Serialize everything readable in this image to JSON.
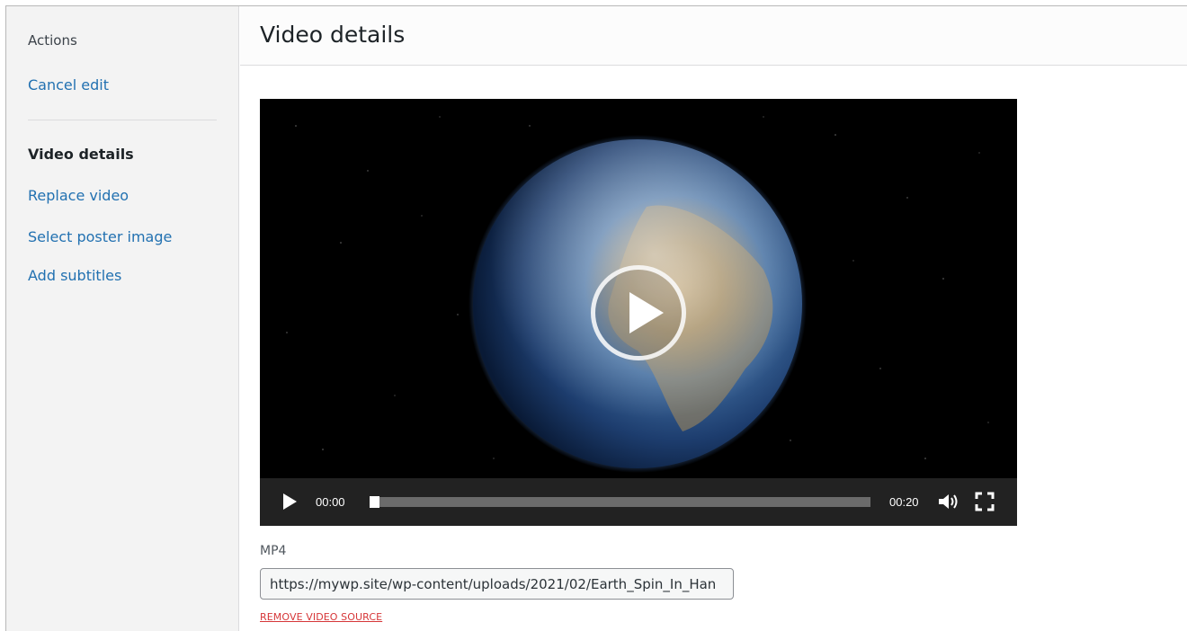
{
  "sidebar": {
    "heading": "Actions",
    "cancel": "Cancel edit",
    "current": "Video details",
    "items": [
      "Replace video",
      "Select poster image",
      "Add subtitles"
    ]
  },
  "main": {
    "title": "Video details",
    "player": {
      "current_time": "00:00",
      "duration": "00:20",
      "progress": 0,
      "icons": [
        "play-icon",
        "volume-icon",
        "fullscreen-icon"
      ]
    },
    "source": {
      "label": "MP4",
      "value": "https://mywp.site/wp-content/uploads/2021/02/Earth_Spin_In_Han",
      "remove": "REMOVE VIDEO SOURCE"
    }
  },
  "colors": {
    "link": "#2271b1",
    "danger": "#d63638",
    "sidebar_bg": "#f3f3f3",
    "control_bar": "#222222"
  }
}
